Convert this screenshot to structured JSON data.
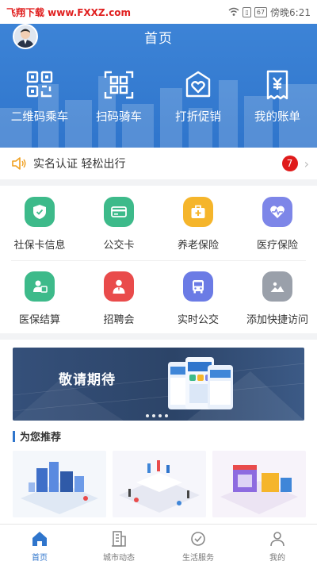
{
  "status_bar": {
    "left_text": "飞翔下载 www.FXXZ.com",
    "battery": "67",
    "time": "傍晚6:21"
  },
  "header": {
    "title": "首页",
    "quick_actions": [
      {
        "label": "二维码乘车",
        "icon": "qr-code-icon"
      },
      {
        "label": "扫码骑车",
        "icon": "scan-icon"
      },
      {
        "label": "打折促销",
        "icon": "shopping-bag-heart-icon"
      },
      {
        "label": "我的账单",
        "icon": "bill-icon"
      }
    ]
  },
  "notice": {
    "text": "实名认证 轻松出行",
    "badge_count": "7",
    "icon": "speaker-icon"
  },
  "services": {
    "row1": [
      {
        "label": "社保卡信息",
        "icon": "shield-check-icon",
        "color": "#3dba8a"
      },
      {
        "label": "公交卡",
        "icon": "card-icon",
        "color": "#3dba8a"
      },
      {
        "label": "养老保险",
        "icon": "medical-kit-icon",
        "color": "#f5b52b"
      },
      {
        "label": "医疗保险",
        "icon": "heart-pulse-icon",
        "color": "#7d86e8"
      }
    ],
    "row2": [
      {
        "label": "医保结算",
        "icon": "person-card-icon",
        "color": "#3dba8a"
      },
      {
        "label": "招聘会",
        "icon": "person-tie-icon",
        "color": "#e94b4b"
      },
      {
        "label": "实时公交",
        "icon": "bus-icon",
        "color": "#6b7be5"
      },
      {
        "label": "添加快捷访问",
        "icon": "image-icon",
        "color": "#9aa0aa"
      }
    ]
  },
  "banner": {
    "text": "敬请期待"
  },
  "recommend": {
    "title": "为您推荐"
  },
  "tabbar": [
    {
      "label": "首页",
      "icon": "home-icon",
      "active": true
    },
    {
      "label": "城市动态",
      "icon": "building-icon",
      "active": false
    },
    {
      "label": "生活服务",
      "icon": "life-service-icon",
      "active": false
    },
    {
      "label": "我的",
      "icon": "profile-icon",
      "active": false
    }
  ],
  "colors": {
    "primary": "#2f75cc",
    "badge": "#e01b1b"
  }
}
